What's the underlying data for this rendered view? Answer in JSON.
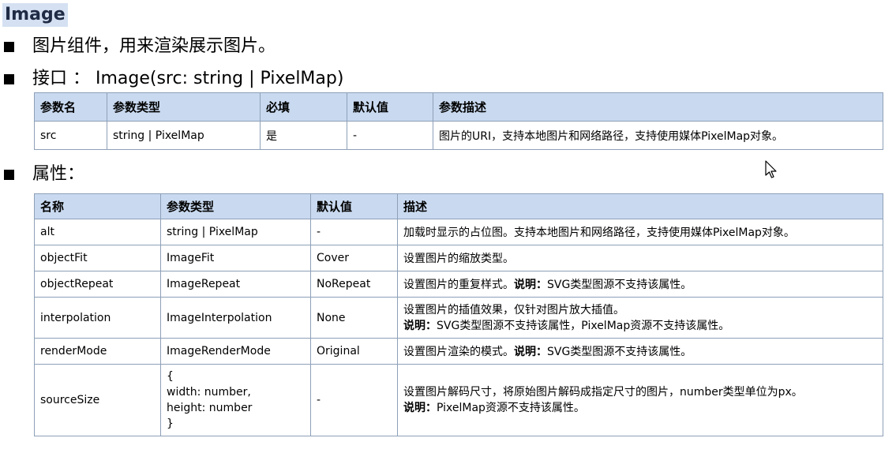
{
  "title": "Image",
  "bullets": {
    "desc": "图片组件，用来渲染展示图片。",
    "iface": "接口 ： Image(src: string | PixelMap)",
    "attr": "属性："
  },
  "interface_table": {
    "headers": [
      "参数名",
      "参数类型",
      "必填",
      "默认值",
      "参数描述"
    ],
    "row": [
      "src",
      "string | PixelMap",
      "是",
      "-",
      "图片的URI，支持本地图片和网络路径，支持使用媒体PixelMap对象。"
    ]
  },
  "attr_table": {
    "headers": [
      "名称",
      "参数类型",
      "默认值",
      "描述"
    ],
    "rows": [
      {
        "name": "alt",
        "type": "string | PixelMap",
        "def": "-",
        "desc": "加载时显示的占位图。支持本地图片和网络路径，支持使用媒体PixelMap对象。",
        "note_label": "",
        "note": ""
      },
      {
        "name": "objectFit",
        "type": "ImageFit",
        "def": "Cover",
        "desc": "设置图片的缩放类型。",
        "note_label": "",
        "note": ""
      },
      {
        "name": "objectRepeat",
        "type": "ImageRepeat",
        "def": "NoRepeat",
        "desc": "设置图片的重复样式。",
        "note_label": "说明：",
        "note": "SVG类型图源不支持该属性。"
      },
      {
        "name": "interpolation",
        "type": "ImageInterpolation",
        "def": "None",
        "desc": "设置图片的插值效果，仅针对图片放大插值。",
        "note_label": "说明：",
        "note": "SVG类型图源不支持该属性，PixelMap资源不支持该属性。"
      },
      {
        "name": "renderMode",
        "type": "ImageRenderMode",
        "def": "Original",
        "desc": "设置图片渲染的模式。",
        "note_label": "说明：",
        "note": "SVG类型图源不支持该属性。"
      },
      {
        "name": "sourceSize",
        "type_lines": [
          "{",
          "width: number,",
          "height: number",
          "}"
        ],
        "def": "-",
        "desc": "设置图片解码尺寸，将原始图片解码成指定尺寸的图片，number类型单位为px。",
        "note_label": "说明：",
        "note": "PixelMap资源不支持该属性。"
      }
    ]
  },
  "icons": {
    "cursor": "mouse-pointer-icon"
  }
}
